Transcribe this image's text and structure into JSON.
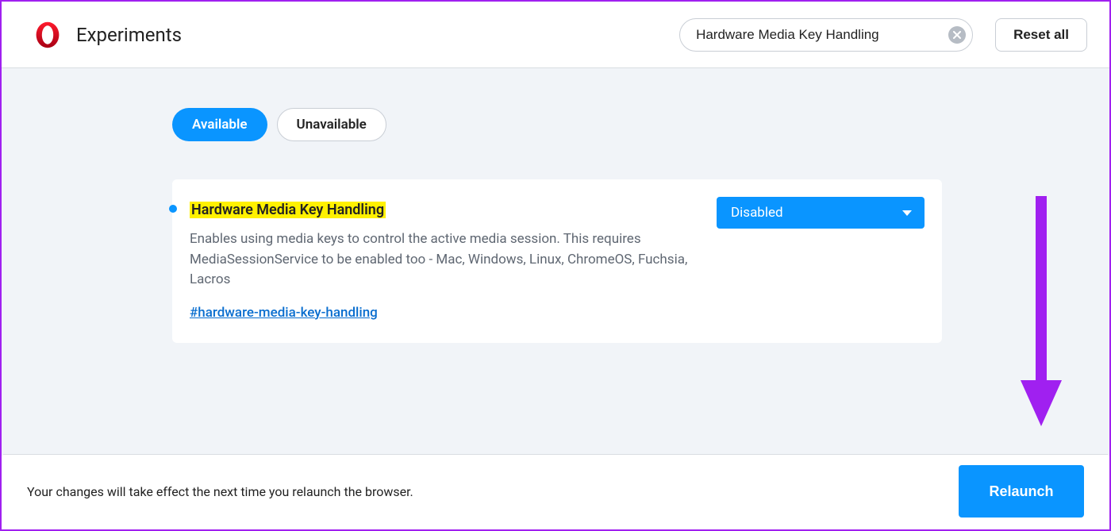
{
  "header": {
    "title": "Experiments",
    "search_value": "Hardware Media Key Handling",
    "reset_label": "Reset all"
  },
  "tabs": {
    "available": "Available",
    "unavailable": "Unavailable"
  },
  "flag": {
    "title": "Hardware Media Key Handling",
    "description": "Enables using media keys to control the active media session. This requires MediaSessionService to be enabled too - Mac, Windows, Linux, ChromeOS, Fuchsia, Lacros",
    "hash": "#hardware-media-key-handling",
    "select_value": "Disabled"
  },
  "footer": {
    "message": "Your changes will take effect the next time you relaunch the browser.",
    "relaunch_label": "Relaunch"
  },
  "colors": {
    "accent": "#0a95ff",
    "highlight": "#fff100",
    "arrow": "#a020f0"
  }
}
